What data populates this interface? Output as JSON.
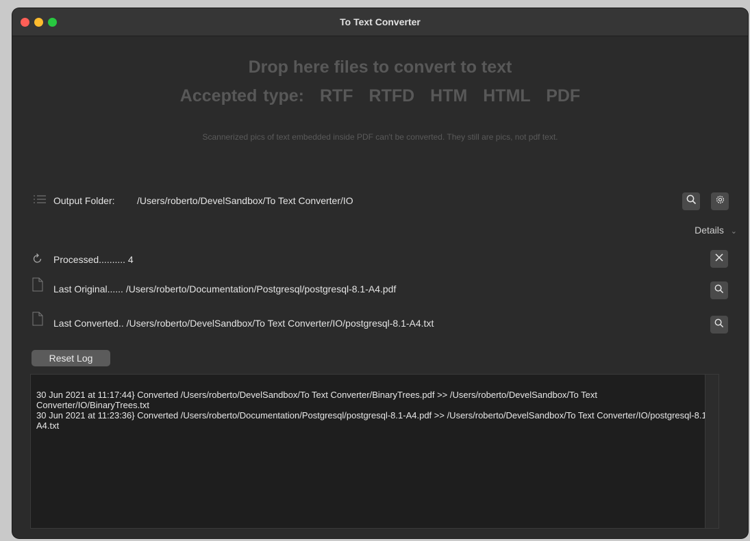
{
  "window": {
    "title": "To Text Converter"
  },
  "drop": {
    "title": "Drop here files to convert to text",
    "accepted_label": "Accepted type:",
    "types": [
      "RTF",
      "RTFD",
      "HTM",
      "HTML",
      "PDF"
    ],
    "note": "Scannerized pics of text embedded inside PDF can't be converted. They still are pics, not pdf text."
  },
  "output": {
    "label": "Output Folder:",
    "path": "/Users/roberto/DevelSandbox/To Text Converter/IO"
  },
  "details": {
    "label": "Details"
  },
  "status": {
    "processed_label": "Processed.......... 4",
    "last_original_label": "Last Original...... /Users/roberto/Documentation/Postgresql/postgresql-8.1-A4.pdf",
    "last_converted_label": "Last Converted.. /Users/roberto/DevelSandbox/To Text Converter/IO/postgresql-8.1-A4.txt"
  },
  "reset_button": "Reset Log",
  "log": {
    "entries": [
      "30 Jun 2021 at 11:17:44} Converted /Users/roberto/DevelSandbox/To Text Converter/BinaryTrees.pdf  >>  /Users/roberto/DevelSandbox/To Text Converter/IO/BinaryTrees.txt",
      "30 Jun 2021 at 11:23:36} Converted /Users/roberto/Documentation/Postgresql/postgresql-8.1-A4.pdf  >>  /Users/roberto/DevelSandbox/To Text Converter/IO/postgresql-8.1-A4.txt"
    ]
  },
  "icons": {
    "list": "list-icon",
    "search": "search-icon",
    "gear": "gear-icon",
    "refresh": "refresh-icon",
    "close": "close-icon",
    "document": "document-icon",
    "chevron": "chevron-down-icon"
  },
  "colors": {
    "window_bg": "#2b2b2b",
    "titlebar_bg": "#363636",
    "close_light": "#fe5f57",
    "min_light": "#febc2e",
    "max_light": "#28c840",
    "dim_text": "#585858"
  }
}
